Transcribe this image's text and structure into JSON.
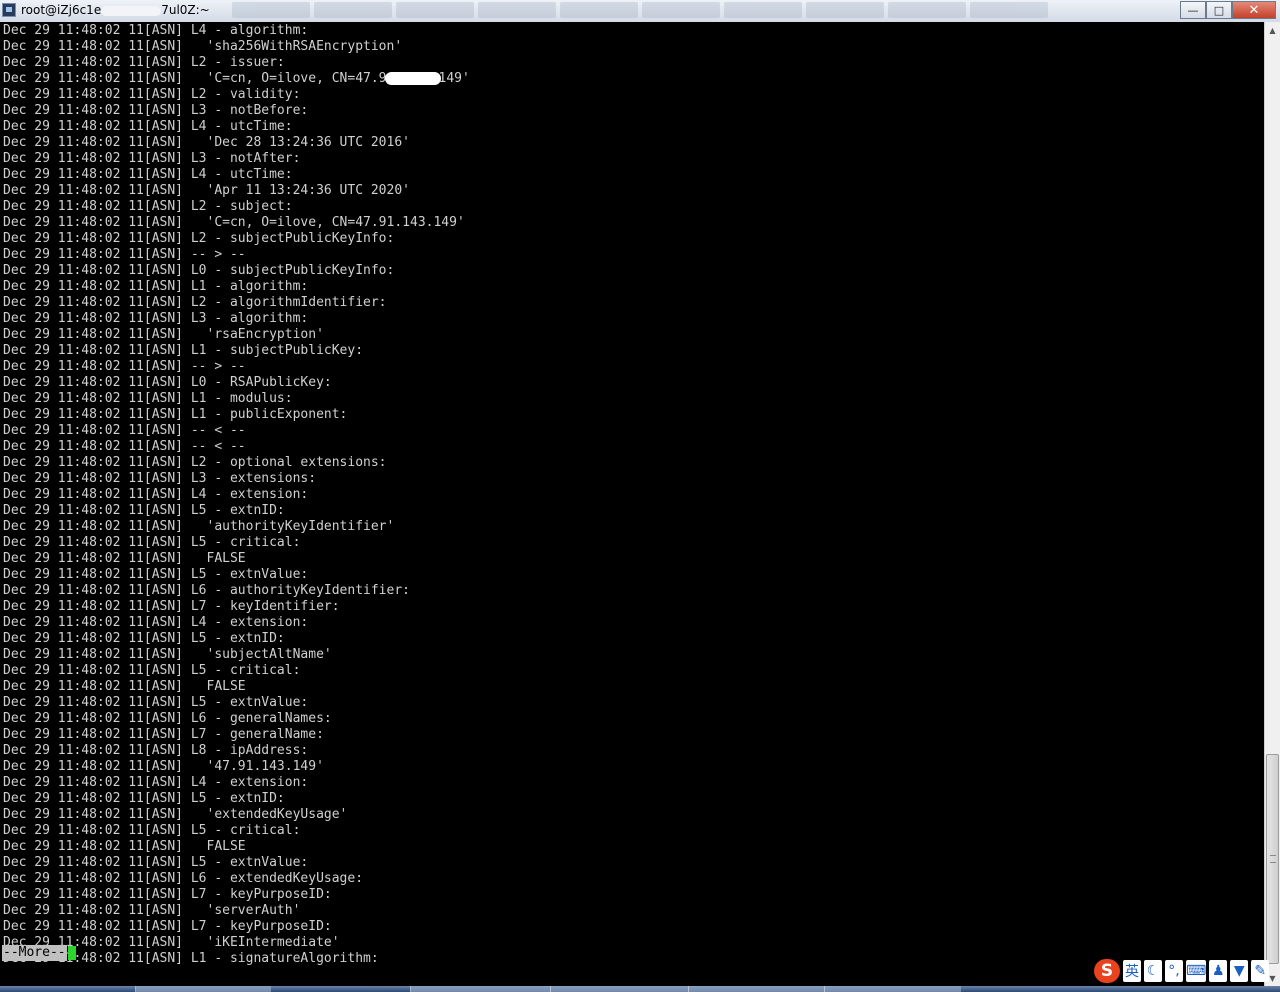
{
  "window": {
    "title_prefix": "root@iZj6c1e",
    "title_suffix": "7ul0Z:~",
    "minimize": "—",
    "maximize": "□",
    "close": "✕"
  },
  "terminal": {
    "prefix": "Dec 29 11:48:02 11[ASN] ",
    "lines": [
      "L4 - algorithm:",
      "  'sha256WithRSAEncryption'",
      "L2 - issuer:",
      "  'C=cn, O=ilove, CN=47.9",
      "L2 - validity:",
      "L3 - notBefore:",
      "L4 - utcTime:",
      "  'Dec 28 13:24:36 UTC 2016'",
      "L3 - notAfter:",
      "L4 - utcTime:",
      "  'Apr 11 13:24:36 UTC 2020'",
      "L2 - subject:",
      "  'C=cn, O=ilove, CN=47.91.143.149'",
      "L2 - subjectPublicKeyInfo:",
      "-- > --",
      "L0 - subjectPublicKeyInfo:",
      "L1 - algorithm:",
      "L2 - algorithmIdentifier:",
      "L3 - algorithm:",
      "  'rsaEncryption'",
      "L1 - subjectPublicKey:",
      "-- > --",
      "L0 - RSAPublicKey:",
      "L1 - modulus:",
      "L1 - publicExponent:",
      "-- < --",
      "-- < --",
      "L2 - optional extensions:",
      "L3 - extensions:",
      "L4 - extension:",
      "L5 - extnID:",
      "  'authorityKeyIdentifier'",
      "L5 - critical:",
      "  FALSE",
      "L5 - extnValue:",
      "L6 - authorityKeyIdentifier:",
      "L7 - keyIdentifier:",
      "L4 - extension:",
      "L5 - extnID:",
      "  'subjectAltName'",
      "L5 - critical:",
      "  FALSE",
      "L5 - extnValue:",
      "L6 - generalNames:",
      "L7 - generalName:",
      "L8 - ipAddress:",
      "  '47.91.143.149'",
      "L4 - extension:",
      "L5 - extnID:",
      "  'extendedKeyUsage'",
      "L5 - critical:",
      "  FALSE",
      "L5 - extnValue:",
      "L6 - extendedKeyUsage:",
      "L7 - keyPurposeID:",
      "  'serverAuth'",
      "L7 - keyPurposeID:",
      "  'iKEIntermediate'",
      "L1 - signatureAlgorithm:"
    ],
    "redacted_tail": "149'",
    "more_prompt": "--More--"
  },
  "scrollbar": {
    "up_arrow": "▲",
    "down_arrow": "▼"
  },
  "ime": {
    "logo": "S",
    "lang": "英",
    "moon": "☾",
    "punct": "°,",
    "keyboard": "⌨",
    "user": "♟",
    "shirt": "▼",
    "wrench": "✎"
  }
}
